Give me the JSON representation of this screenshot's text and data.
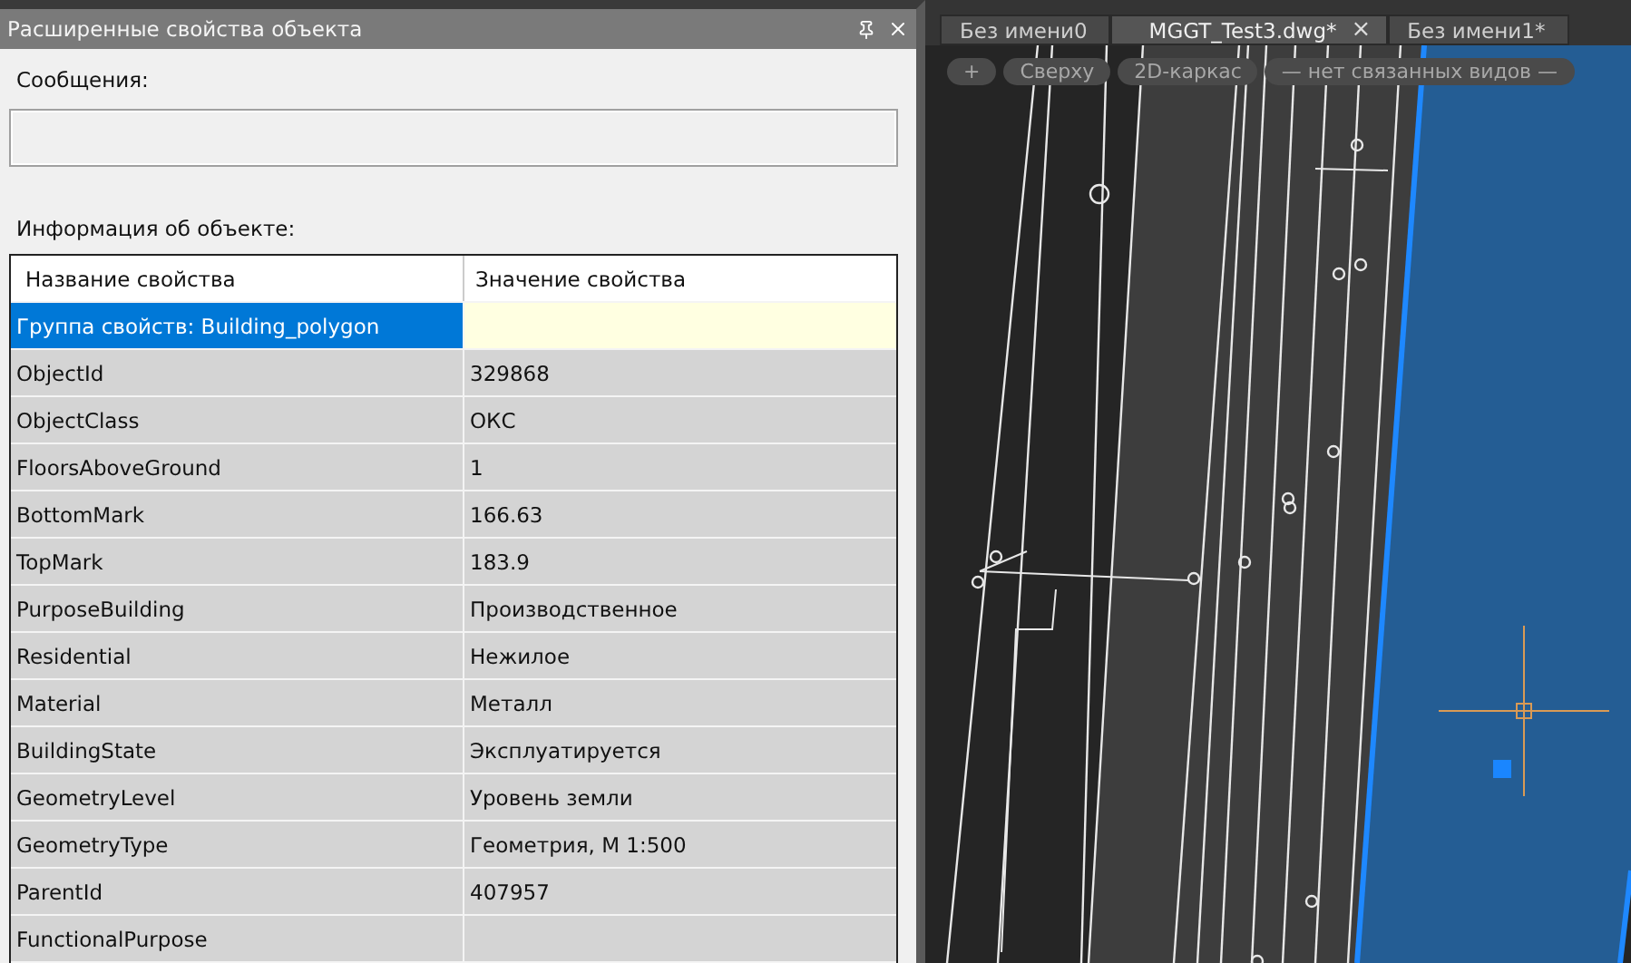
{
  "panel": {
    "title": "Расширенные свойства объекта",
    "messages_label": "Сообщения:",
    "info_label": "Информация об объекте:"
  },
  "table": {
    "columns": [
      "Название свойства",
      "Значение свойства"
    ],
    "rows": [
      {
        "kind": "group",
        "name": "Группа свойств: Building_polygon",
        "value": "",
        "selected": true
      },
      {
        "kind": "property",
        "name": "ObjectId",
        "value": "329868",
        "selected": false
      },
      {
        "kind": "property",
        "name": "ObjectClass",
        "value": "ОКС",
        "selected": false
      },
      {
        "kind": "property",
        "name": "FloorsAboveGround",
        "value": "1",
        "selected": false
      },
      {
        "kind": "property",
        "name": "BottomMark",
        "value": "166.63",
        "selected": false
      },
      {
        "kind": "property",
        "name": "TopMark",
        "value": "183.9",
        "selected": false
      },
      {
        "kind": "property",
        "name": "PurposeBuilding",
        "value": "Производственное",
        "selected": false
      },
      {
        "kind": "property",
        "name": "Residential",
        "value": "Нежилое",
        "selected": false
      },
      {
        "kind": "property",
        "name": "Material",
        "value": "Металл",
        "selected": false
      },
      {
        "kind": "property",
        "name": "BuildingState",
        "value": "Эксплуатируется",
        "selected": false
      },
      {
        "kind": "property",
        "name": "GeometryLevel",
        "value": "Уровень земли",
        "selected": false
      },
      {
        "kind": "property",
        "name": "GeometryType",
        "value": "Геометрия, М 1:500",
        "selected": false
      },
      {
        "kind": "property",
        "name": "ParentId",
        "value": "407957",
        "selected": false
      },
      {
        "kind": "property",
        "name": "FunctionalPurpose",
        "value": "",
        "selected": false
      }
    ]
  },
  "drawing_tabs": [
    {
      "label": "Без имени0",
      "selected": false
    },
    {
      "label": "MGGT_Test3.dwg*",
      "selected": true,
      "close": "×"
    },
    {
      "label": "Без имени1*",
      "selected": false
    }
  ],
  "viewport_controls": [
    "+",
    "Сверху",
    "2D-каркас",
    "— нет связанных видов —"
  ]
}
